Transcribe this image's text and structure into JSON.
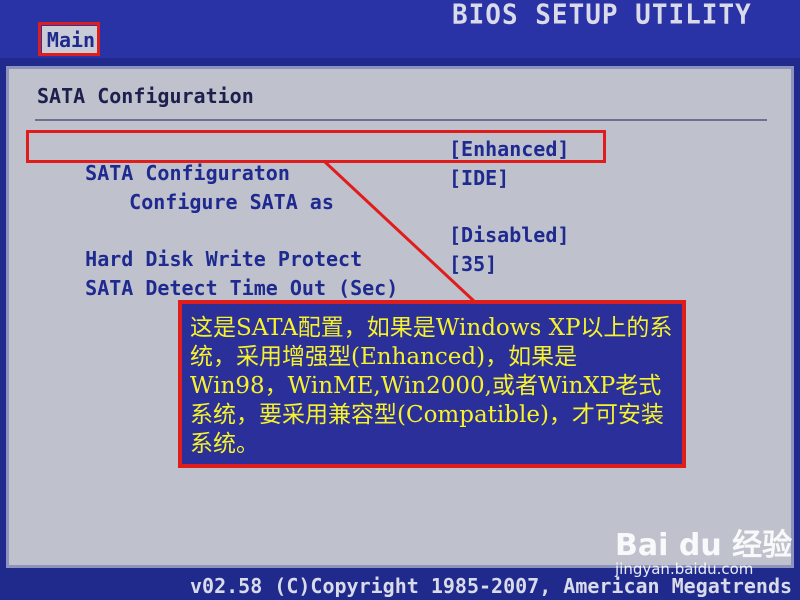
{
  "header": {
    "title": "BIOS SETUP UTILITY",
    "tab": "Main"
  },
  "panel": {
    "title": "SATA Configuration",
    "rows": [
      {
        "label": "SATA Configuraton",
        "value": "[Enhanced]"
      },
      {
        "label": "Configure SATA as",
        "value": "[IDE]"
      },
      {
        "label": "Hard Disk Write Protect",
        "value": "[Disabled]"
      },
      {
        "label": "SATA Detect Time Out (Sec)",
        "value": "[35]"
      }
    ]
  },
  "callout": {
    "text": "这是SATA配置，如果是Windows XP以上的系统，采用增强型(Enhanced)，如果是Win98，WinME,Win2000,或者WinXP老式系统，要采用兼容型(Compatible)，才可安装系统。"
  },
  "footer": {
    "text": "v02.58 (C)Copyright 1985-2007, American Megatrends"
  },
  "watermark": {
    "logo": "Bai du 经验",
    "site": "jingyan.baidu.com"
  },
  "colors": {
    "highlight": "#e01d1d",
    "panel": "#bfc2cc",
    "background": "#1f2a8c",
    "callout_text": "#f6f32a"
  }
}
